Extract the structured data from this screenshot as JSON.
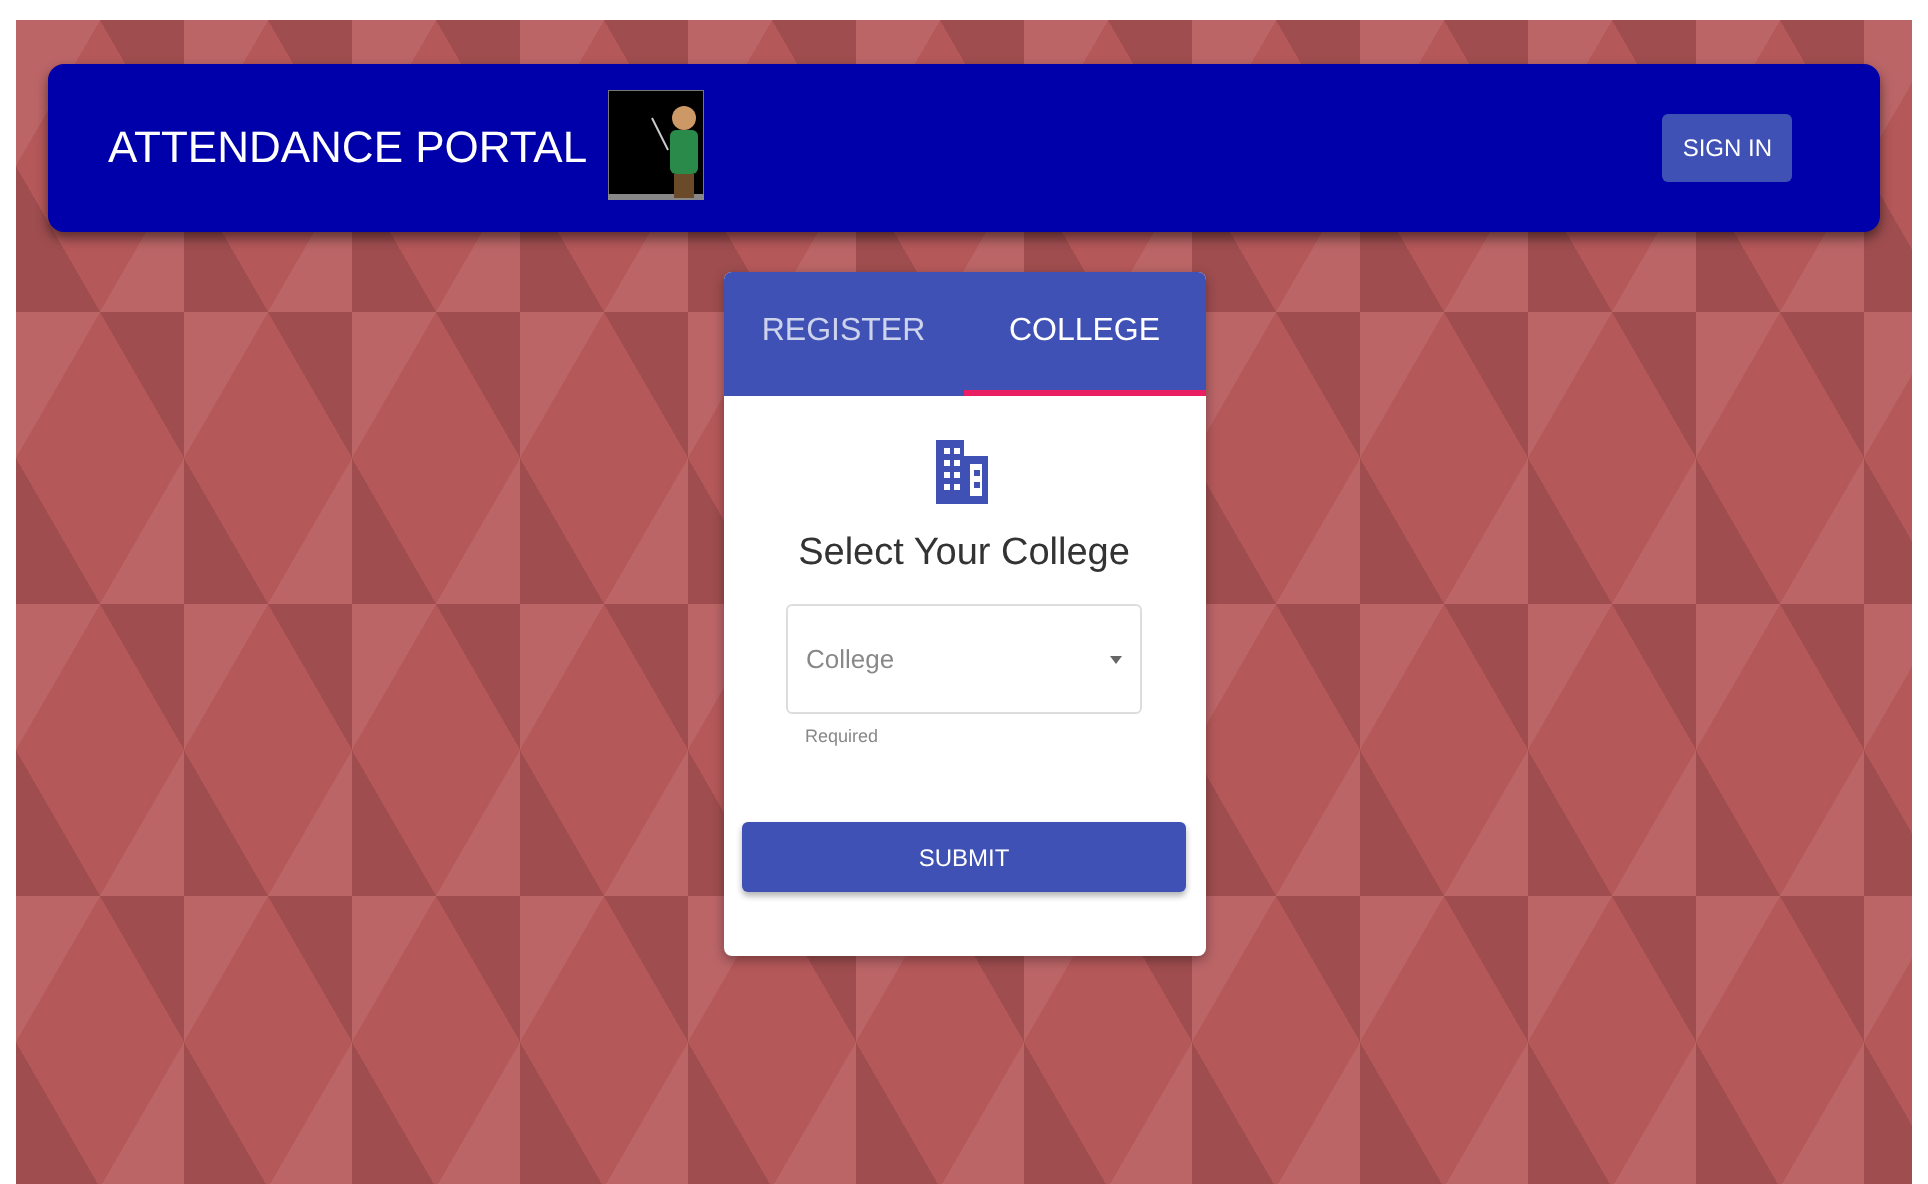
{
  "header": {
    "title": "ATTENDANCE PORTAL",
    "sign_in": "SIGN IN"
  },
  "tabs": [
    {
      "label": "REGISTER",
      "selected": false
    },
    {
      "label": "COLLEGE",
      "selected": true
    }
  ],
  "form": {
    "heading": "Select Your College",
    "field": {
      "placeholder": "College",
      "helper": "Required"
    },
    "submit": "SUBMIT"
  }
}
